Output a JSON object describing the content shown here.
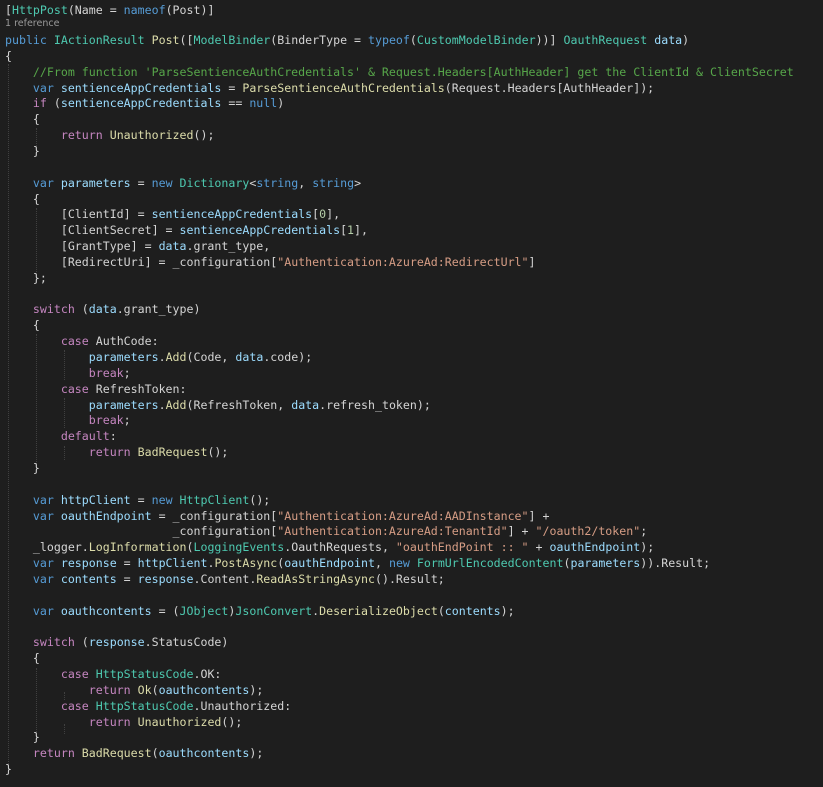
{
  "editor": {
    "codelens": "1 reference",
    "lines": [
      [
        [
          "[",
          "#d4d4d4"
        ],
        [
          "HttpPost",
          "#4ec9b0"
        ],
        [
          "(Name = ",
          "#d4d4d4"
        ],
        [
          "nameof",
          "#569cd6"
        ],
        [
          "(Post)]",
          "#d4d4d4"
        ]
      ],
      [
        [
          "public ",
          "#569cd6"
        ],
        [
          "IActionResult ",
          "#4ec9b0"
        ],
        [
          "Post",
          "#dcdcaa"
        ],
        [
          "([",
          "#d4d4d4"
        ],
        [
          "ModelBinder",
          "#4ec9b0"
        ],
        [
          "(BinderType = ",
          "#d4d4d4"
        ],
        [
          "typeof",
          "#569cd6"
        ],
        [
          "(",
          "#d4d4d4"
        ],
        [
          "CustomModelBinder",
          "#4ec9b0"
        ],
        [
          "))] ",
          "#d4d4d4"
        ],
        [
          "OauthRequest ",
          "#4ec9b0"
        ],
        [
          "data",
          "#9cdcfe"
        ],
        [
          ")",
          "#d4d4d4"
        ]
      ],
      [
        [
          "{",
          "#d4d4d4"
        ]
      ],
      [
        [
          "    ",
          "#d4d4d4"
        ],
        [
          "//From function 'ParseSentienceAuthCredentials' & Request.Headers[AuthHeader] get the ClientId & ClientSecret",
          "#57a64a"
        ]
      ],
      [
        [
          "    ",
          "#d4d4d4"
        ],
        [
          "var ",
          "#569cd6"
        ],
        [
          "sentienceAppCredentials",
          "#9cdcfe"
        ],
        [
          " = ",
          "#d4d4d4"
        ],
        [
          "ParseSentienceAuthCredentials",
          "#dcdcaa"
        ],
        [
          "(Request.Headers[AuthHeader]);",
          "#d4d4d4"
        ]
      ],
      [
        [
          "    ",
          "#d4d4d4"
        ],
        [
          "if ",
          "#c586c0"
        ],
        [
          "(",
          "#d4d4d4"
        ],
        [
          "sentienceAppCredentials",
          "#9cdcfe"
        ],
        [
          " == ",
          "#d4d4d4"
        ],
        [
          "null",
          "#569cd6"
        ],
        [
          ")",
          "#d4d4d4"
        ]
      ],
      [
        [
          "    {",
          "#d4d4d4"
        ]
      ],
      [
        [
          "        ",
          "#d4d4d4"
        ],
        [
          "return ",
          "#c586c0"
        ],
        [
          "Unauthorized",
          "#dcdcaa"
        ],
        [
          "();",
          "#d4d4d4"
        ]
      ],
      [
        [
          "    }",
          "#d4d4d4"
        ]
      ],
      [],
      [
        [
          "    ",
          "#d4d4d4"
        ],
        [
          "var ",
          "#569cd6"
        ],
        [
          "parameters",
          "#9cdcfe"
        ],
        [
          " = ",
          "#d4d4d4"
        ],
        [
          "new ",
          "#569cd6"
        ],
        [
          "Dictionary",
          "#4ec9b0"
        ],
        [
          "<",
          "#d4d4d4"
        ],
        [
          "string",
          "#569cd6"
        ],
        [
          ", ",
          "#d4d4d4"
        ],
        [
          "string",
          "#569cd6"
        ],
        [
          ">",
          "#d4d4d4"
        ]
      ],
      [
        [
          "    {",
          "#d4d4d4"
        ]
      ],
      [
        [
          "        [ClientId] = ",
          "#d4d4d4"
        ],
        [
          "sentienceAppCredentials",
          "#9cdcfe"
        ],
        [
          "[",
          "#d4d4d4"
        ],
        [
          "0",
          "#b5cea8"
        ],
        [
          "],",
          "#d4d4d4"
        ]
      ],
      [
        [
          "        [ClientSecret] = ",
          "#d4d4d4"
        ],
        [
          "sentienceAppCredentials",
          "#9cdcfe"
        ],
        [
          "[",
          "#d4d4d4"
        ],
        [
          "1",
          "#b5cea8"
        ],
        [
          "],",
          "#d4d4d4"
        ]
      ],
      [
        [
          "        [GrantType] = ",
          "#d4d4d4"
        ],
        [
          "data",
          "#9cdcfe"
        ],
        [
          ".grant_type,",
          "#d4d4d4"
        ]
      ],
      [
        [
          "        [RedirectUri] = _configuration[",
          "#d4d4d4"
        ],
        [
          "\"Authentication:AzureAd:RedirectUrl\"",
          "#d69d85"
        ],
        [
          "]",
          "#d4d4d4"
        ]
      ],
      [
        [
          "    };",
          "#d4d4d4"
        ]
      ],
      [],
      [
        [
          "    ",
          "#d4d4d4"
        ],
        [
          "switch ",
          "#c586c0"
        ],
        [
          "(",
          "#d4d4d4"
        ],
        [
          "data",
          "#9cdcfe"
        ],
        [
          ".grant_type)",
          "#d4d4d4"
        ]
      ],
      [
        [
          "    {",
          "#d4d4d4"
        ]
      ],
      [
        [
          "        ",
          "#d4d4d4"
        ],
        [
          "case ",
          "#c586c0"
        ],
        [
          "AuthCode:",
          "#d4d4d4"
        ]
      ],
      [
        [
          "            ",
          "#d4d4d4"
        ],
        [
          "parameters",
          "#9cdcfe"
        ],
        [
          ".",
          "#d4d4d4"
        ],
        [
          "Add",
          "#dcdcaa"
        ],
        [
          "(Code, ",
          "#d4d4d4"
        ],
        [
          "data",
          "#9cdcfe"
        ],
        [
          ".code);",
          "#d4d4d4"
        ]
      ],
      [
        [
          "            ",
          "#d4d4d4"
        ],
        [
          "break",
          "#c586c0"
        ],
        [
          ";",
          "#d4d4d4"
        ]
      ],
      [
        [
          "        ",
          "#d4d4d4"
        ],
        [
          "case ",
          "#c586c0"
        ],
        [
          "RefreshToken:",
          "#d4d4d4"
        ]
      ],
      [
        [
          "            ",
          "#d4d4d4"
        ],
        [
          "parameters",
          "#9cdcfe"
        ],
        [
          ".",
          "#d4d4d4"
        ],
        [
          "Add",
          "#dcdcaa"
        ],
        [
          "(RefreshToken, ",
          "#d4d4d4"
        ],
        [
          "data",
          "#9cdcfe"
        ],
        [
          ".refresh_token);",
          "#d4d4d4"
        ]
      ],
      [
        [
          "            ",
          "#d4d4d4"
        ],
        [
          "break",
          "#c586c0"
        ],
        [
          ";",
          "#d4d4d4"
        ]
      ],
      [
        [
          "        ",
          "#d4d4d4"
        ],
        [
          "default",
          "#c586c0"
        ],
        [
          ":",
          "#d4d4d4"
        ]
      ],
      [
        [
          "            ",
          "#d4d4d4"
        ],
        [
          "return ",
          "#c586c0"
        ],
        [
          "BadRequest",
          "#dcdcaa"
        ],
        [
          "();",
          "#d4d4d4"
        ]
      ],
      [
        [
          "    }",
          "#d4d4d4"
        ]
      ],
      [],
      [
        [
          "    ",
          "#d4d4d4"
        ],
        [
          "var ",
          "#569cd6"
        ],
        [
          "httpClient",
          "#9cdcfe"
        ],
        [
          " = ",
          "#d4d4d4"
        ],
        [
          "new ",
          "#569cd6"
        ],
        [
          "HttpClient",
          "#4ec9b0"
        ],
        [
          "();",
          "#d4d4d4"
        ]
      ],
      [
        [
          "    ",
          "#d4d4d4"
        ],
        [
          "var ",
          "#569cd6"
        ],
        [
          "oauthEndpoint",
          "#9cdcfe"
        ],
        [
          " = _configuration[",
          "#d4d4d4"
        ],
        [
          "\"Authentication:AzureAd:AADInstance\"",
          "#d69d85"
        ],
        [
          "] +",
          "#d4d4d4"
        ]
      ],
      [
        [
          "                        _configuration[",
          "#d4d4d4"
        ],
        [
          "\"Authentication:AzureAd:TenantId\"",
          "#d69d85"
        ],
        [
          "] + ",
          "#d4d4d4"
        ],
        [
          "\"/oauth2/token\"",
          "#d69d85"
        ],
        [
          ";",
          "#d4d4d4"
        ]
      ],
      [
        [
          "    _logger.",
          "#d4d4d4"
        ],
        [
          "LogInformation",
          "#dcdcaa"
        ],
        [
          "(",
          "#d4d4d4"
        ],
        [
          "LoggingEvents",
          "#4ec9b0"
        ],
        [
          ".OauthRequests, ",
          "#d4d4d4"
        ],
        [
          "\"oauthEndPoint :: \"",
          "#d69d85"
        ],
        [
          " + ",
          "#d4d4d4"
        ],
        [
          "oauthEndpoint",
          "#9cdcfe"
        ],
        [
          ");",
          "#d4d4d4"
        ]
      ],
      [
        [
          "    ",
          "#d4d4d4"
        ],
        [
          "var ",
          "#569cd6"
        ],
        [
          "response",
          "#9cdcfe"
        ],
        [
          " = ",
          "#d4d4d4"
        ],
        [
          "httpClient",
          "#9cdcfe"
        ],
        [
          ".",
          "#d4d4d4"
        ],
        [
          "PostAsync",
          "#dcdcaa"
        ],
        [
          "(",
          "#d4d4d4"
        ],
        [
          "oauthEndpoint",
          "#9cdcfe"
        ],
        [
          ", ",
          "#d4d4d4"
        ],
        [
          "new ",
          "#569cd6"
        ],
        [
          "FormUrlEncodedContent",
          "#4ec9b0"
        ],
        [
          "(",
          "#d4d4d4"
        ],
        [
          "parameters",
          "#9cdcfe"
        ],
        [
          ")).Result;",
          "#d4d4d4"
        ]
      ],
      [
        [
          "    ",
          "#d4d4d4"
        ],
        [
          "var ",
          "#569cd6"
        ],
        [
          "contents",
          "#9cdcfe"
        ],
        [
          " = ",
          "#d4d4d4"
        ],
        [
          "response",
          "#9cdcfe"
        ],
        [
          ".Content.",
          "#d4d4d4"
        ],
        [
          "ReadAsStringAsync",
          "#dcdcaa"
        ],
        [
          "().Result;",
          "#d4d4d4"
        ]
      ],
      [],
      [
        [
          "    ",
          "#d4d4d4"
        ],
        [
          "var ",
          "#569cd6"
        ],
        [
          "oauthcontents",
          "#9cdcfe"
        ],
        [
          " = (",
          "#d4d4d4"
        ],
        [
          "JObject",
          "#4ec9b0"
        ],
        [
          ")",
          "#d4d4d4"
        ],
        [
          "JsonConvert",
          "#4ec9b0"
        ],
        [
          ".",
          "#d4d4d4"
        ],
        [
          "DeserializeObject",
          "#dcdcaa"
        ],
        [
          "(",
          "#d4d4d4"
        ],
        [
          "contents",
          "#9cdcfe"
        ],
        [
          ");",
          "#d4d4d4"
        ]
      ],
      [],
      [
        [
          "    ",
          "#d4d4d4"
        ],
        [
          "switch ",
          "#c586c0"
        ],
        [
          "(",
          "#d4d4d4"
        ],
        [
          "response",
          "#9cdcfe"
        ],
        [
          ".StatusCode)",
          "#d4d4d4"
        ]
      ],
      [
        [
          "    {",
          "#d4d4d4"
        ]
      ],
      [
        [
          "        ",
          "#d4d4d4"
        ],
        [
          "case ",
          "#c586c0"
        ],
        [
          "HttpStatusCode",
          "#4ec9b0"
        ],
        [
          ".OK:",
          "#d4d4d4"
        ]
      ],
      [
        [
          "            ",
          "#d4d4d4"
        ],
        [
          "return ",
          "#c586c0"
        ],
        [
          "Ok",
          "#dcdcaa"
        ],
        [
          "(",
          "#d4d4d4"
        ],
        [
          "oauthcontents",
          "#9cdcfe"
        ],
        [
          ");",
          "#d4d4d4"
        ]
      ],
      [
        [
          "        ",
          "#d4d4d4"
        ],
        [
          "case ",
          "#c586c0"
        ],
        [
          "HttpStatusCode",
          "#4ec9b0"
        ],
        [
          ".Unauthorized:",
          "#d4d4d4"
        ]
      ],
      [
        [
          "            ",
          "#d4d4d4"
        ],
        [
          "return ",
          "#c586c0"
        ],
        [
          "Unauthorized",
          "#dcdcaa"
        ],
        [
          "();",
          "#d4d4d4"
        ]
      ],
      [
        [
          "    }",
          "#d4d4d4"
        ]
      ],
      [
        [
          "    ",
          "#d4d4d4"
        ],
        [
          "return ",
          "#c586c0"
        ],
        [
          "BadRequest",
          "#dcdcaa"
        ],
        [
          "(",
          "#d4d4d4"
        ],
        [
          "oauthcontents",
          "#9cdcfe"
        ],
        [
          ");",
          "#d4d4d4"
        ]
      ],
      [
        [
          "}",
          "#d4d4d4"
        ]
      ]
    ]
  }
}
